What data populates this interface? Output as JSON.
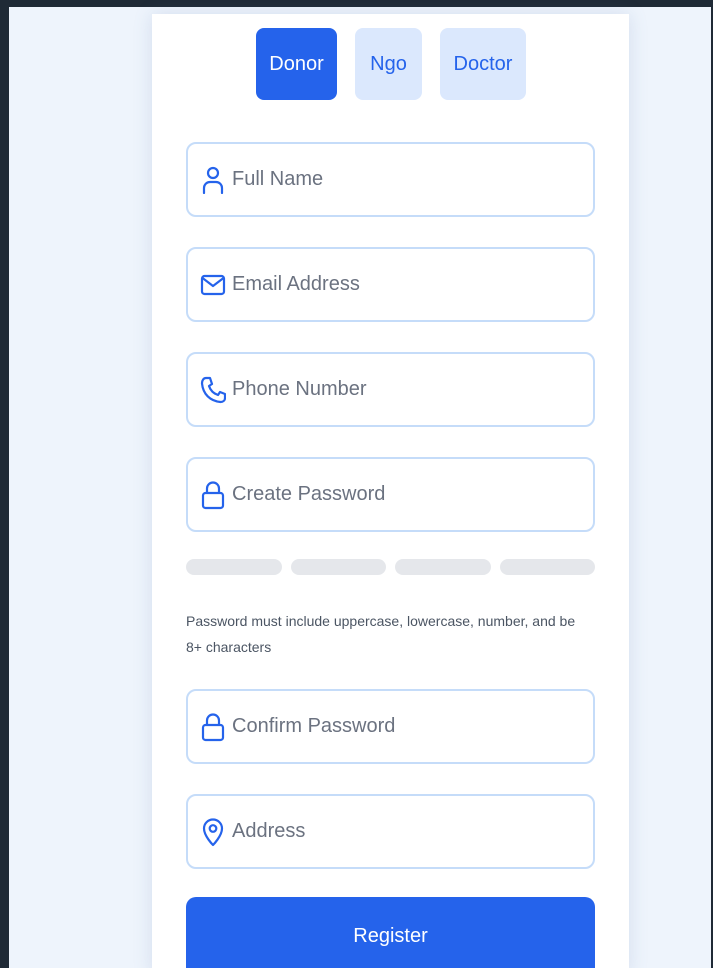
{
  "tabs": {
    "donor": "Donor",
    "ngo": "Ngo",
    "doctor": "Doctor",
    "active": "Donor"
  },
  "fields": {
    "full_name": {
      "placeholder": "Full Name",
      "value": "",
      "icon": "user-icon"
    },
    "email": {
      "placeholder": "Email Address",
      "value": "",
      "icon": "mail-icon"
    },
    "phone": {
      "placeholder": "Phone Number",
      "value": "",
      "icon": "phone-icon"
    },
    "password": {
      "placeholder": "Create Password",
      "value": "",
      "icon": "lock-icon"
    },
    "confirm_password": {
      "placeholder": "Confirm Password",
      "value": "",
      "icon": "lock-icon"
    },
    "address": {
      "placeholder": "Address",
      "value": "",
      "icon": "map-pin-icon"
    }
  },
  "password_strength": {
    "level": 0,
    "segments": 4
  },
  "hint": "Password must include uppercase, lowercase, number, and be 8+ characters",
  "register_label": "Register",
  "colors": {
    "accent": "#2563eb",
    "tab_inactive_bg": "#dbe8fd",
    "field_border": "#c5dcf9",
    "page_bg": "#eef4fc"
  }
}
